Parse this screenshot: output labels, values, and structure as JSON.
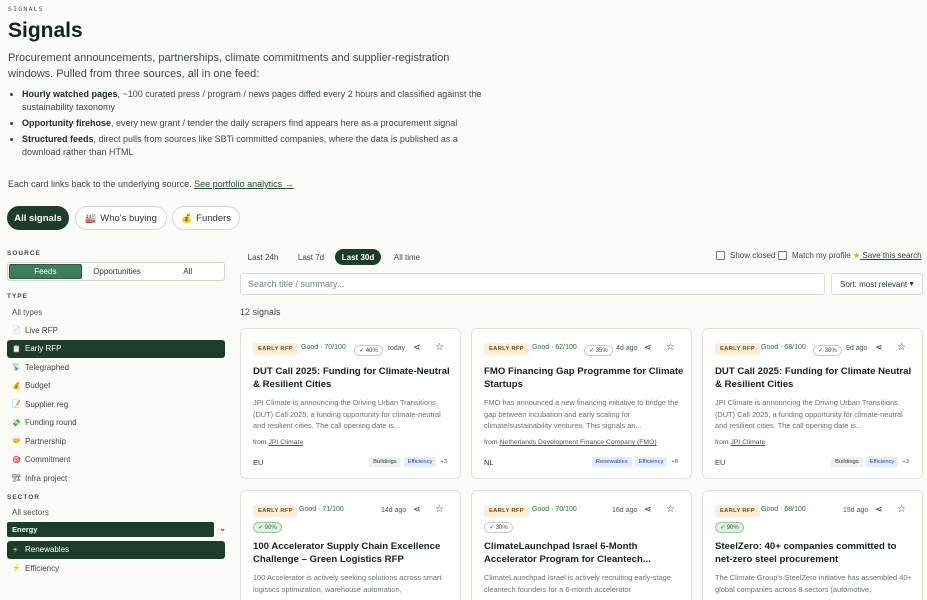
{
  "header": {
    "kicker": "SIGNALS",
    "title": "Signals",
    "intro": "Procurement announcements, partnerships, climate commitments and supplier-registration windows. Pulled from three sources, all in one feed:",
    "bullets": [
      {
        "bold": "Hourly watched pages",
        "text": ", ~100 curated press / program / news pages diffed every 2 hours and classified against the sustainability taxonomy"
      },
      {
        "bold": "Opportunity firehose",
        "text": ", every new grant / tender the daily scrapers find appears here as a procurement signal"
      },
      {
        "bold": "Structured feeds",
        "text": ", direct pulls from sources like SBTi committed companies, where the data is published as a download rather than HTML"
      }
    ],
    "footnote": "Each card links back to the underlying source.",
    "footnote_link": "See portfolio analytics →"
  },
  "tabs": {
    "all": "All signals",
    "buying": "Who's buying",
    "funders": "Funders",
    "buying_icon": "factory-icon",
    "funders_icon": "money-bag-icon"
  },
  "sidebar": {
    "source_label": "SOURCE",
    "source_opts": [
      "Feeds",
      "Opportunities",
      "All"
    ],
    "type_label": "TYPE",
    "all_types": "All types",
    "types": [
      {
        "label": "Live RFP",
        "icon": "📄"
      },
      {
        "label": "Early RFP",
        "icon": "📋"
      },
      {
        "label": "Telegraphed",
        "icon": "📡"
      },
      {
        "label": "Budget",
        "icon": "💰"
      },
      {
        "label": "Supplier reg",
        "icon": "📝"
      },
      {
        "label": "Funding round",
        "icon": "💸"
      },
      {
        "label": "Partnership",
        "icon": "🤝"
      },
      {
        "label": "Commitment",
        "icon": "🎯"
      },
      {
        "label": "Infra project",
        "icon": "🏗"
      }
    ],
    "sector_label": "SECTOR",
    "all_sectors": "All sectors",
    "sector_dropdown": "Energy",
    "sectors": [
      {
        "label": "Renewables",
        "icon": "☀"
      },
      {
        "label": "Efficiency",
        "icon": "⚡"
      }
    ]
  },
  "filters": {
    "ranges": [
      "Last 24h",
      "Last 7d",
      "Last 30d",
      "All time"
    ],
    "show_closed": "Show closed",
    "match_profile": "Match my profile",
    "save_search": "Save this search",
    "search_placeholder": "Search title / summary...",
    "sort": "Sort: most relevant",
    "count": "12 signals"
  },
  "cards": [
    {
      "tag": "EARLY RFP",
      "score": "Good · 70/100",
      "conf": "✓ 40%",
      "age": "today",
      "title": "DUT Call 2025: Funding for Climate-Neutral & Resilient Cities",
      "body": "JPI Climate is announcing the Driving Urban Transitions (DUT) Call 2025, a funding opportunity for climate-neutral and resilient cities. The call opening date is...",
      "from_label": "from",
      "from": "JPI Climate",
      "geo": "EU",
      "chips": [
        "Buildings",
        "Efficiency"
      ],
      "more": "+3"
    },
    {
      "tag": "EARLY RFP",
      "score": "Good · 62/100",
      "conf": "✓ 35%",
      "age": "4d ago",
      "title": "FMO Financing Gap Programme for Climate Startups",
      "body": "FMO has announced a new financing initiative to bridge the gap between incubation and early scaling for climate/sustainability ventures. This signals an...",
      "from_label": "from",
      "from": "Netherlands Development Finance Company (FMO)",
      "geo": "NL",
      "chips": [
        "Renewables",
        "Efficiency"
      ],
      "more": "+8"
    },
    {
      "tag": "EARLY RFP",
      "score": "Good · 68/100",
      "conf": "✓ 30%",
      "age": "9d ago",
      "title": "DUT Call 2025: Funding for Climate Neutral & Resilient Cities",
      "body": "JPI Climate is announcing the Driving Urban Transitions (DUT) Call 2025, a funding opportunity for climate-neutral and resilient cities. The call opening date is...",
      "from_label": "from",
      "from": "JPI Climate",
      "geo": "EU",
      "chips": [
        "Buildings",
        "Efficiency"
      ],
      "more": "+3"
    },
    {
      "tag": "EARLY RFP",
      "score": "Good · 71/100",
      "conf": "✓ 90%",
      "age": "14d ago",
      "title": "100 Accelerator Supply Chain Excellence Challenge – Green Logistics RFP",
      "body": "100 Accelerator is actively seeking solutions across smart logistics optimization, warehouse automation,"
    },
    {
      "tag": "EARLY RFP",
      "score": "Good · 70/100",
      "conf": "✓ 30%",
      "age": "16d ago",
      "title": "ClimateLaunchpad Israel 6-Month Accelerator Program for Cleantech...",
      "body": "ClimateLaunchpad Israel is actively recruiting early-stage cleantech founders for a 6-month accelerator"
    },
    {
      "tag": "EARLY RFP",
      "score": "Good · 68/100",
      "conf": "✓ 90%",
      "age": "15d ago",
      "title": "SteelZero: 40+ companies committed to net-zero steel procurement",
      "body": "The Climate Group's SteelZero initiative has assembled 40+ global companies across 8 sectors (automotive,"
    }
  ]
}
